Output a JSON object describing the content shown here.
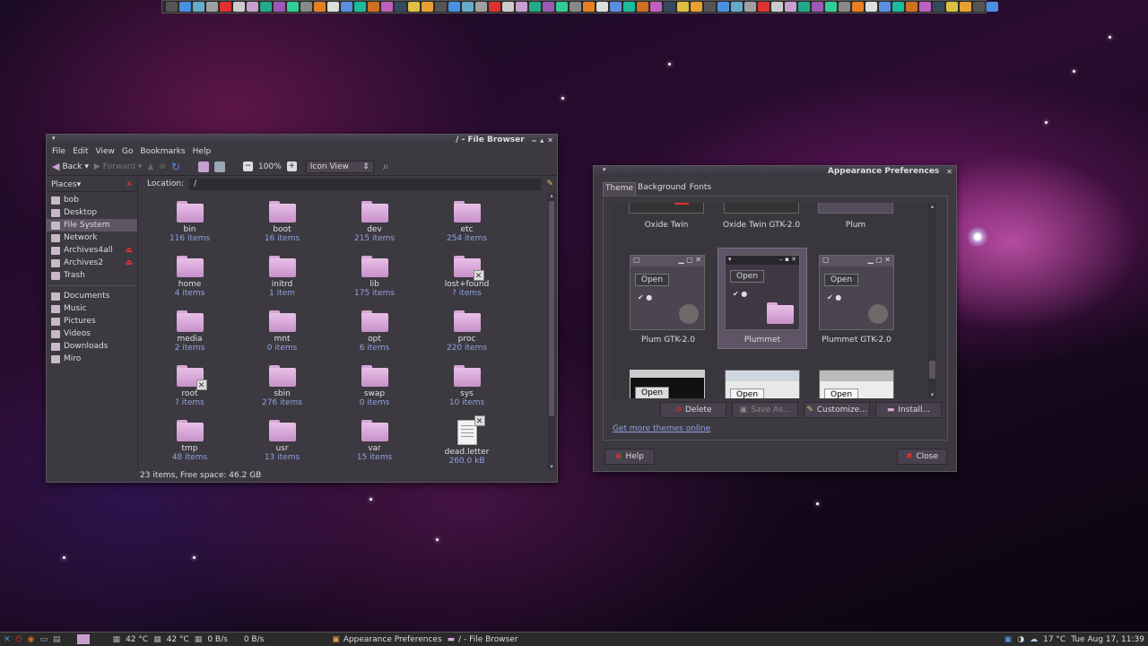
{
  "file_browser": {
    "title": "/ - File Browser",
    "menu": [
      "File",
      "Edit",
      "View",
      "Go",
      "Bookmarks",
      "Help"
    ],
    "toolbar": {
      "back": "Back",
      "forward": "Forward",
      "zoom": "100%",
      "view": "Icon View"
    },
    "places_label": "Places",
    "location_label": "Location:",
    "location_value": "/",
    "places": [
      {
        "label": "bob",
        "icon": "home-folder-icon"
      },
      {
        "label": "Desktop",
        "icon": "desktop-icon"
      },
      {
        "label": "File System",
        "icon": "drive-icon",
        "selected": true
      },
      {
        "label": "Network",
        "icon": "network-icon"
      },
      {
        "label": "Archives4all",
        "icon": "drive-icon",
        "eject": true
      },
      {
        "label": "Archives2",
        "icon": "drive-icon",
        "eject": true
      },
      {
        "label": "Trash",
        "icon": "trash-icon"
      }
    ],
    "bookmarks": [
      "Documents",
      "Music",
      "Pictures",
      "Videos",
      "Downloads",
      "Miro"
    ],
    "files": [
      {
        "name": "bin",
        "count": "116 items"
      },
      {
        "name": "boot",
        "count": "16 items"
      },
      {
        "name": "dev",
        "count": "215 items"
      },
      {
        "name": "etc",
        "count": "254 items"
      },
      {
        "name": "home",
        "count": "4 items"
      },
      {
        "name": "initrd",
        "count": "1 item"
      },
      {
        "name": "lib",
        "count": "175 items"
      },
      {
        "name": "lost+found",
        "count": "? items",
        "locked": true
      },
      {
        "name": "media",
        "count": "2 items"
      },
      {
        "name": "mnt",
        "count": "0 items"
      },
      {
        "name": "opt",
        "count": "6 items"
      },
      {
        "name": "proc",
        "count": "220 items"
      },
      {
        "name": "root",
        "count": "? items",
        "locked": true
      },
      {
        "name": "sbin",
        "count": "276 items"
      },
      {
        "name": "swap",
        "count": "0 items"
      },
      {
        "name": "sys",
        "count": "10 items"
      },
      {
        "name": "tmp",
        "count": "48 items"
      },
      {
        "name": "usr",
        "count": "13 items"
      },
      {
        "name": "var",
        "count": "15 items"
      },
      {
        "name": "dead.letter",
        "count": "260.0 kB",
        "file": true,
        "locked": true
      }
    ],
    "status": "23 items, Free space: 46.2 GB"
  },
  "appearance": {
    "title": "Appearance Preferences",
    "tabs": [
      "Theme",
      "Background",
      "Fonts"
    ],
    "themes_top": [
      "Oxide Twin",
      "Oxide Twin GTK-2.0",
      "Plum"
    ],
    "themes_mid": [
      "Plum GTK-2.0",
      "Plummet",
      "Plummet GTK-2.0"
    ],
    "preview_open": "Open",
    "buttons": {
      "delete": "Delete",
      "save_as": "Save As...",
      "customize": "Customize...",
      "install": "Install..."
    },
    "more_link": "Get more themes online",
    "help": "Help",
    "close": "Close"
  },
  "bottom_panel": {
    "temp1": "42 °C",
    "temp2": "42 °C",
    "net1": "0 B/s",
    "net2": "0 B/s",
    "tasks": [
      "Appearance Preferences",
      "/ - File Browser"
    ],
    "weather": "17 °C",
    "clock": "Tue Aug 17, 11:39"
  }
}
